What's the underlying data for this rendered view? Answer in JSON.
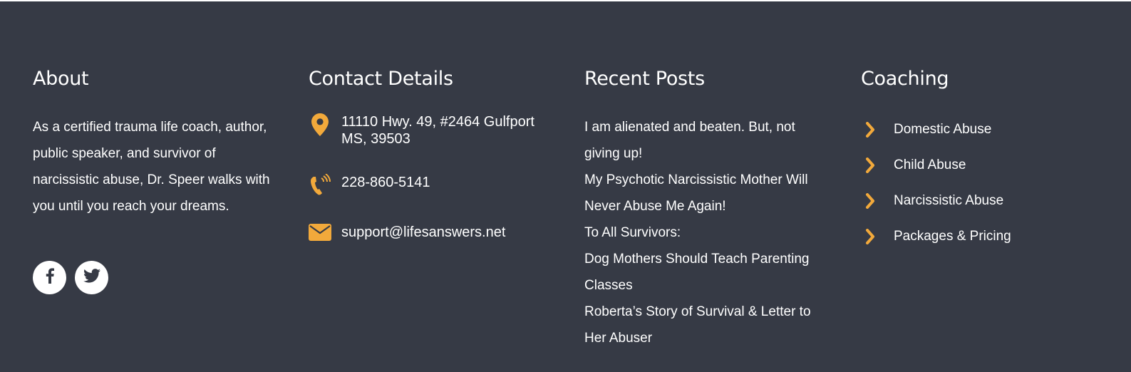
{
  "colors": {
    "background": "#363a45",
    "accent": "#f2a93b",
    "text": "#ffffff"
  },
  "about": {
    "title": "About",
    "text": "As a certified trauma life coach, author, public speaker, and survivor of narcissistic abuse, Dr. Speer walks with you until you reach your dreams.",
    "social": [
      "facebook-icon",
      "twitter-icon"
    ]
  },
  "contact": {
    "title": "Contact Details",
    "address": "11110 Hwy. 49, #2464 Gulfport MS, 39503",
    "phone": "228-860-5141",
    "email": "support@lifesanswers.net",
    "icons": [
      "map-pin-icon",
      "phone-icon",
      "envelope-icon"
    ]
  },
  "posts": {
    "title": "Recent Posts",
    "items": [
      "I am alienated and beaten. But, not giving up!",
      "My Psychotic Narcissistic Mother Will Never Abuse Me Again!",
      "To All Survivors:",
      "Dog Mothers Should Teach Parenting Classes",
      "Roberta’s Story of Survival & Letter to Her Abuser"
    ]
  },
  "coaching": {
    "title": "Coaching",
    "items": [
      "Domestic Abuse",
      "Child Abuse",
      "Narcissistic Abuse",
      "Packages & Pricing"
    ]
  }
}
